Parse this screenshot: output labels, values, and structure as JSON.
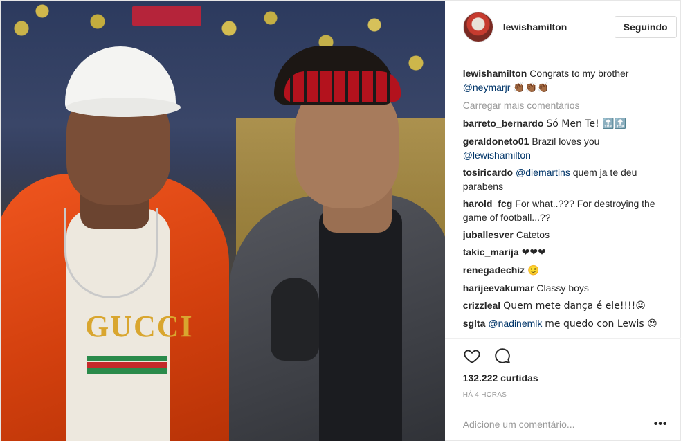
{
  "header": {
    "username": "lewishamilton",
    "follow_label": "Seguindo"
  },
  "caption": {
    "user": "lewishamilton",
    "text": "Congrats to my brother",
    "mention": "@neymarjr",
    "emoji": "👏🏾👏🏾👏🏾"
  },
  "load_more": "Carregar mais comentários",
  "comments": [
    {
      "user": "barreto_bernardo",
      "text": "Só Men Te! 🔝🔝",
      "mention": ""
    },
    {
      "user": "geraldoneto01",
      "text": "Brazil loves you",
      "mention": "@lewishamilton"
    },
    {
      "user": "tosiricardo",
      "text": "quem ja te deu parabens",
      "mention": "@diemartins"
    },
    {
      "user": "harold_fcg",
      "text": "For what..??? For destroying the game of football...??",
      "mention": ""
    },
    {
      "user": "juballesver",
      "text": "Catetos",
      "mention": ""
    },
    {
      "user": "takic_marija",
      "text": "❤❤❤",
      "mention": ""
    },
    {
      "user": "renegadechiz",
      "text": "🙂",
      "mention": ""
    },
    {
      "user": "harijeevakumar",
      "text": "Classy boys",
      "mention": ""
    },
    {
      "user": "crizzleal",
      "text": "Quem mete dança é ele!!!!😜",
      "mention": ""
    },
    {
      "user": "sglta",
      "text": "me quedo con Lewis 😍",
      "mention": "@nadinemlk"
    }
  ],
  "actions": {
    "like_icon": "heart-icon",
    "comment_icon": "comment-bubble-icon",
    "likes_text": "132.222 curtidas",
    "time_text": "HÁ 4 HORAS"
  },
  "add_comment": {
    "placeholder": "Adicione um comentário...",
    "more_icon": "•••"
  },
  "photo": {
    "shirt_text": "GUCCI"
  }
}
